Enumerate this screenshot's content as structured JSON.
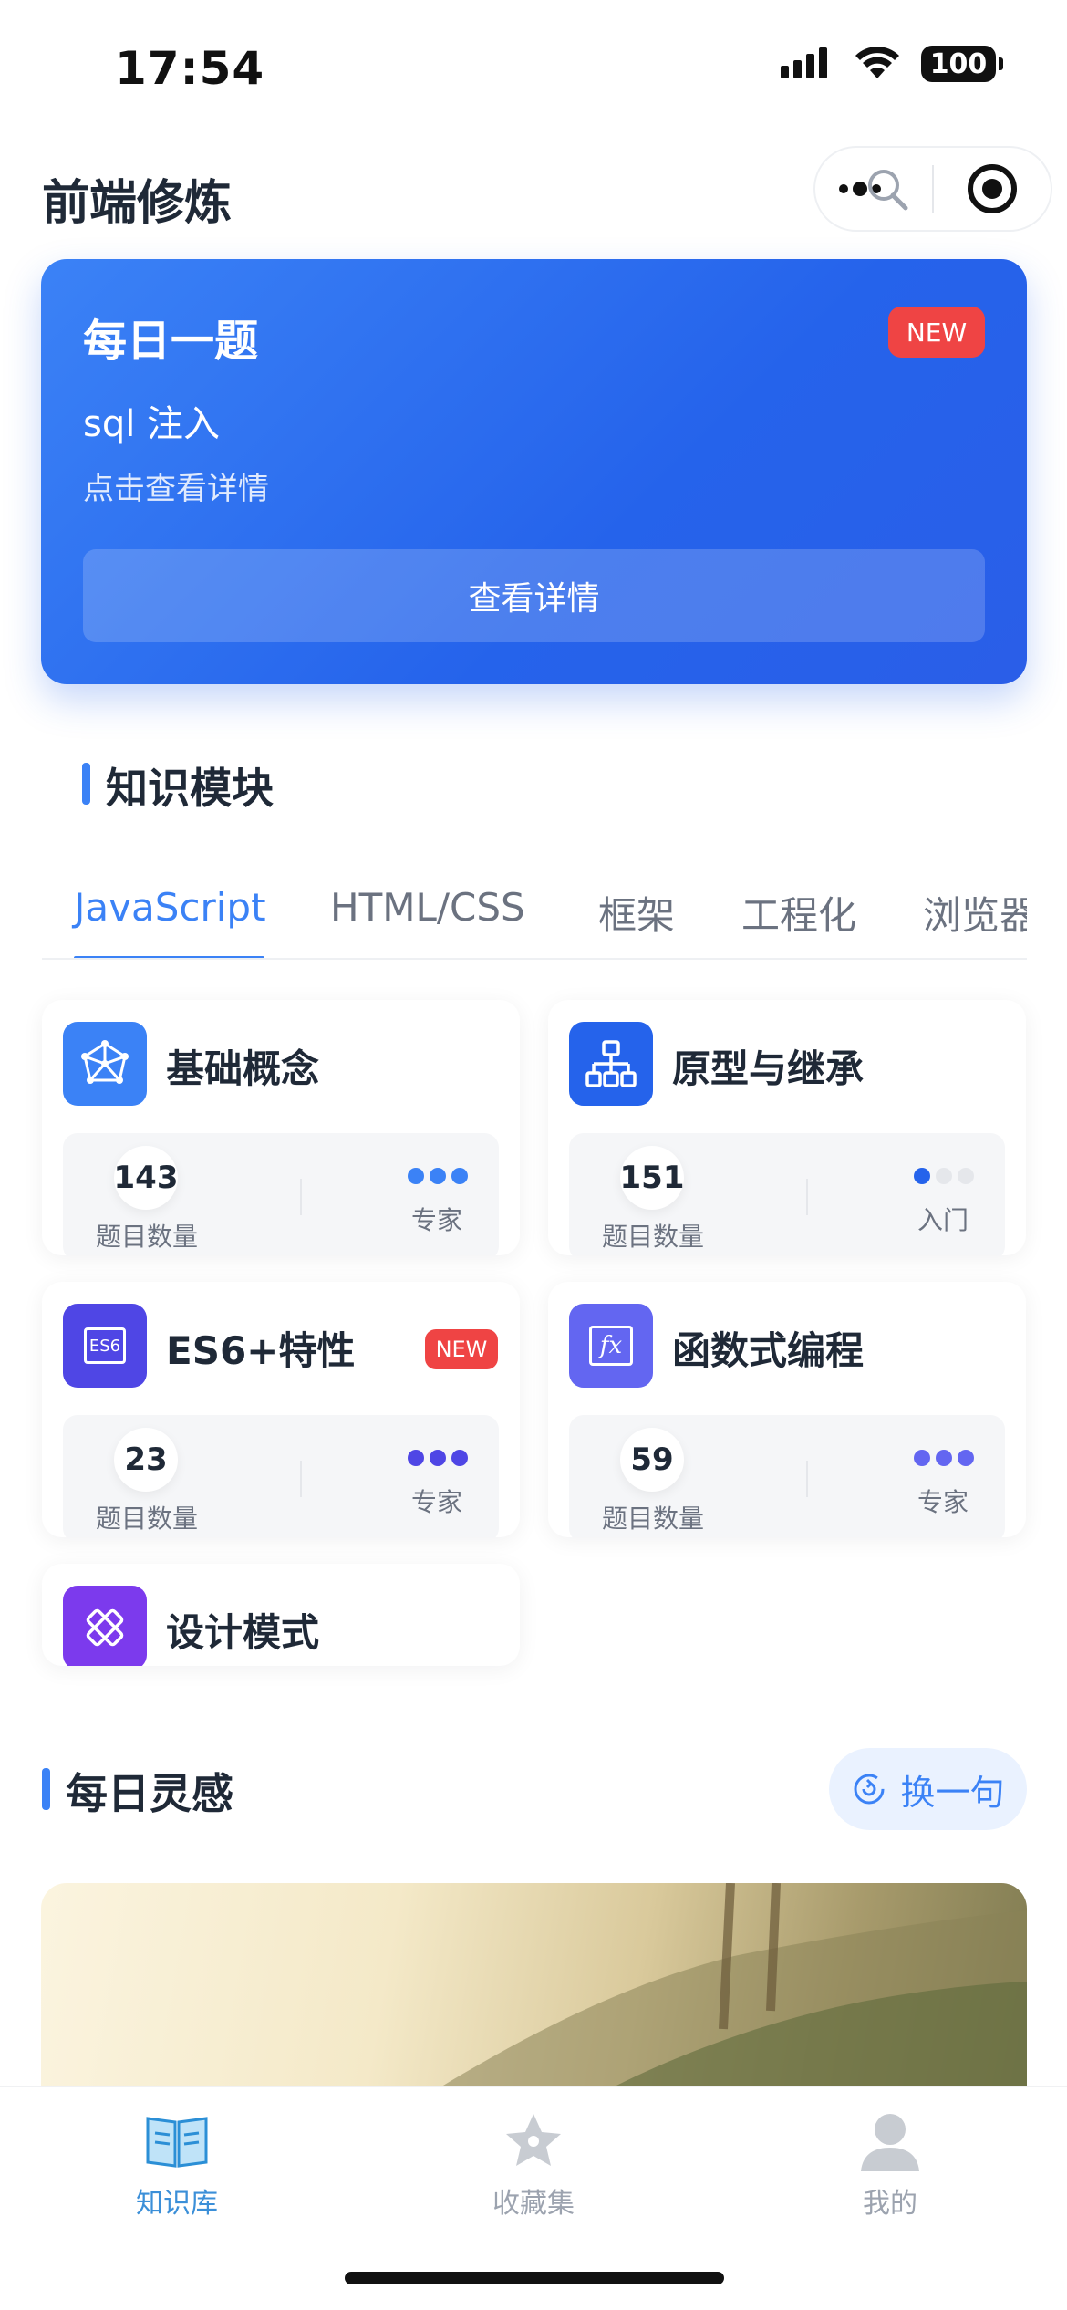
{
  "status_bar": {
    "time": "17:54",
    "battery": "100"
  },
  "header": {
    "title": "前端修炼"
  },
  "daily_question": {
    "title": "每日一题",
    "badge": "NEW",
    "question": "sql 注入",
    "hint": "点击查看详情",
    "button_label": "查看详情"
  },
  "knowledge": {
    "section_title": "知识模块",
    "tabs": [
      {
        "label": "JavaScript",
        "active": true
      },
      {
        "label": "HTML/CSS"
      },
      {
        "label": "框架"
      },
      {
        "label": "工程化"
      },
      {
        "label": "浏览器"
      }
    ],
    "modules": [
      {
        "name": "基础概念",
        "count": "143",
        "count_label": "题目数量",
        "level": "专家",
        "level_dots": 3,
        "icon": "network-icon",
        "color": "#3b82f6"
      },
      {
        "name": "原型与继承",
        "count": "151",
        "count_label": "题目数量",
        "level": "入门",
        "level_dots": 1,
        "icon": "hierarchy-icon",
        "color": "#2563eb"
      },
      {
        "name": "ES6+特性",
        "count": "23",
        "count_label": "题目数量",
        "level": "专家",
        "level_dots": 3,
        "icon": "es6-icon",
        "icon_text": "ES6",
        "color": "#4f46e5",
        "badge": "NEW"
      },
      {
        "name": "函数式编程",
        "count": "59",
        "count_label": "题目数量",
        "level": "专家",
        "level_dots": 3,
        "icon": "function-icon",
        "icon_text": "fx",
        "color": "#6366f1"
      },
      {
        "name": "设计模式",
        "icon": "design-icon",
        "color": "#7c3aed"
      }
    ]
  },
  "inspiration": {
    "section_title": "每日灵感",
    "swap_label": "换一句"
  },
  "tabbar": {
    "items": [
      {
        "label": "知识库",
        "active": true,
        "icon": "book-icon"
      },
      {
        "label": "收藏集",
        "icon": "star-icon"
      },
      {
        "label": "我的",
        "icon": "user-icon"
      }
    ]
  },
  "colors": {
    "accent": "#3b82f6",
    "badge": "#ef4444",
    "inactive": "#9ca3af"
  }
}
